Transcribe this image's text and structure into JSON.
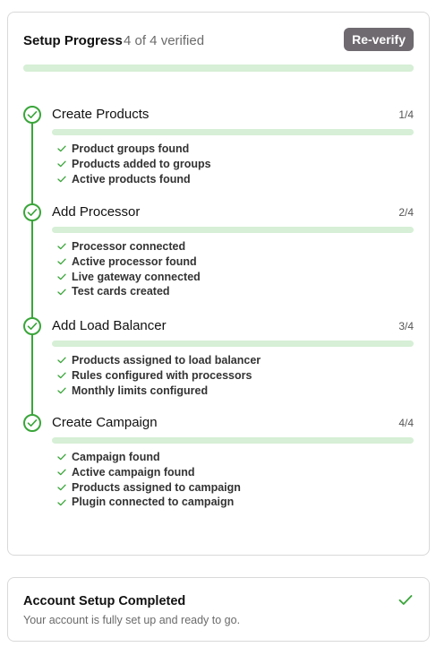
{
  "progress": {
    "title": "Setup Progress",
    "status": "4 of 4 verified",
    "reverify_label": "Re-verify",
    "overall_fraction": 1.0
  },
  "steps": [
    {
      "title": "Create Products",
      "count": "1/4",
      "items": [
        "Product groups found",
        "Products added to groups",
        "Active products found"
      ]
    },
    {
      "title": "Add Processor",
      "count": "2/4",
      "items": [
        "Processor connected",
        "Active processor found",
        "Live gateway connected",
        "Test cards created"
      ]
    },
    {
      "title": "Add Load Balancer",
      "count": "3/4",
      "items": [
        "Products assigned to load balancer",
        "Rules configured with processors",
        "Monthly limits configured"
      ]
    },
    {
      "title": "Create Campaign",
      "count": "4/4",
      "items": [
        "Campaign found",
        "Active campaign found",
        "Products assigned to campaign",
        "Plugin connected to campaign"
      ]
    }
  ],
  "completion": {
    "title": "Account Setup Completed",
    "subtitle": "Your account is fully set up and ready to go."
  },
  "colors": {
    "accent_green": "#3aa53a",
    "bar_green": "#d6efd6",
    "button_bg": "#6f6a70"
  },
  "icons": {
    "step": "check-circle-icon",
    "item": "check-icon",
    "completion": "check-icon"
  }
}
